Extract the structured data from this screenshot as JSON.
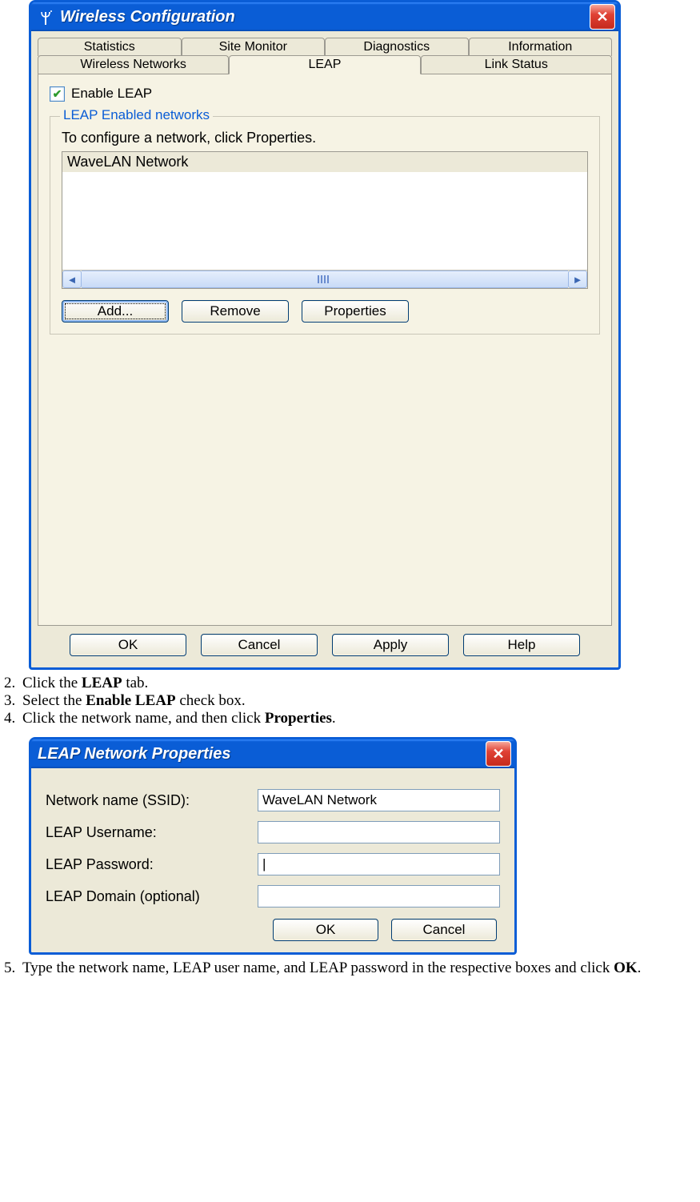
{
  "dlg1": {
    "title": "Wireless Configuration",
    "tabs_back": [
      "Statistics",
      "Site Monitor",
      "Diagnostics",
      "Information"
    ],
    "tabs_front": [
      "Wireless Networks",
      "LEAP",
      "Link Status"
    ],
    "selected_tab": "LEAP",
    "enable_leap_label": "Enable LEAP",
    "enable_leap_checked": true,
    "fieldset_legend": "LEAP Enabled networks",
    "fieldset_hint": "To configure a network, click Properties.",
    "network_items": [
      "WaveLAN Network"
    ],
    "buttons": {
      "add": "Add...",
      "remove": "Remove",
      "props": "Properties"
    },
    "bottom": {
      "ok": "OK",
      "cancel": "Cancel",
      "apply": "Apply",
      "help": "Help"
    }
  },
  "steps": {
    "s2_a": "Click the ",
    "s2_b": "LEAP",
    "s2_c": " tab.",
    "s3_a": "Select the ",
    "s3_b": "Enable LEAP",
    "s3_c": " check box.",
    "s4_a": "Click the network name, and then click ",
    "s4_b": "Properties",
    "s4_c": ".",
    "s5_a": "Type the network name, LEAP user name, and LEAP password in the respective boxes and click ",
    "s5_b": "OK",
    "s5_c": "."
  },
  "dlg2": {
    "title": "LEAP Network Properties",
    "labels": {
      "ssid": "Network name (SSID):",
      "user": "LEAP Username:",
      "pass": "LEAP Password:",
      "domain": "LEAP Domain (optional)"
    },
    "values": {
      "ssid": "WaveLAN Network",
      "user": "",
      "pass": "|",
      "domain": ""
    },
    "buttons": {
      "ok": "OK",
      "cancel": "Cancel"
    }
  }
}
